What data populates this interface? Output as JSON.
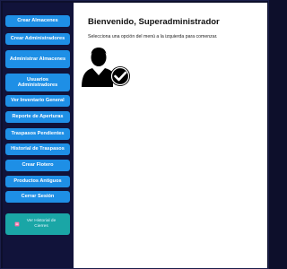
{
  "sidebar": {
    "items": [
      {
        "label": "Crear Almacenes"
      },
      {
        "label": "Crear Administradores"
      },
      {
        "label": "Administrar Almacenes"
      },
      {
        "label": "Usuarios Administradores"
      },
      {
        "label": "Ver Inventario General"
      },
      {
        "label": "Reporte de Aperturas"
      },
      {
        "label": "Traspasos Pendientes"
      },
      {
        "label": "Historial de Traspasos"
      },
      {
        "label": "Crear Flotero"
      },
      {
        "label": "Productos Antiguos"
      },
      {
        "label": "Cerrar Sesión"
      }
    ],
    "history_button": {
      "label": "Ver Historial de Cierres",
      "icon": "history-icon"
    }
  },
  "main": {
    "title": "Bienvenido, Superadministrador",
    "subtitle": "Selecciona una opción del menú a la izquierda para comenzar.",
    "illustration_icon": "admin-user-check-icon"
  },
  "colors": {
    "sidebar_bg": "#11133a",
    "button_bg": "#1e8fe6",
    "history_button_bg": "#1aa6a6",
    "main_bg": "#ffffff"
  }
}
